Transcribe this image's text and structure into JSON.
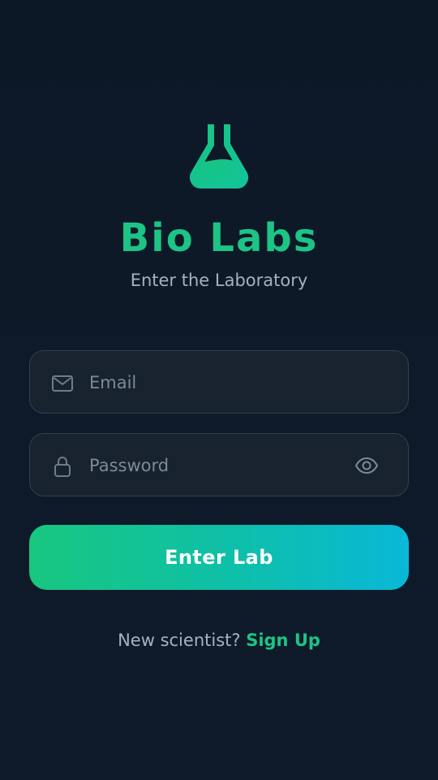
{
  "app": {
    "title": "Bio Labs",
    "subtitle": "Enter the Laboratory",
    "logo_icon": "flask-icon"
  },
  "form": {
    "email": {
      "placeholder": "Email",
      "icon": "mail-icon"
    },
    "password": {
      "placeholder": "Password",
      "icon": "lock-icon",
      "toggle_icon": "eye-icon"
    },
    "submit_label": "Enter Lab"
  },
  "footer": {
    "prompt": "New scientist?",
    "link": "Sign Up"
  },
  "colors": {
    "accent": "#1cc485",
    "background": "#0d1827",
    "field_background": "#18232f",
    "cta_gradient_start": "#18c77f",
    "cta_gradient_end": "#09b8d8"
  }
}
